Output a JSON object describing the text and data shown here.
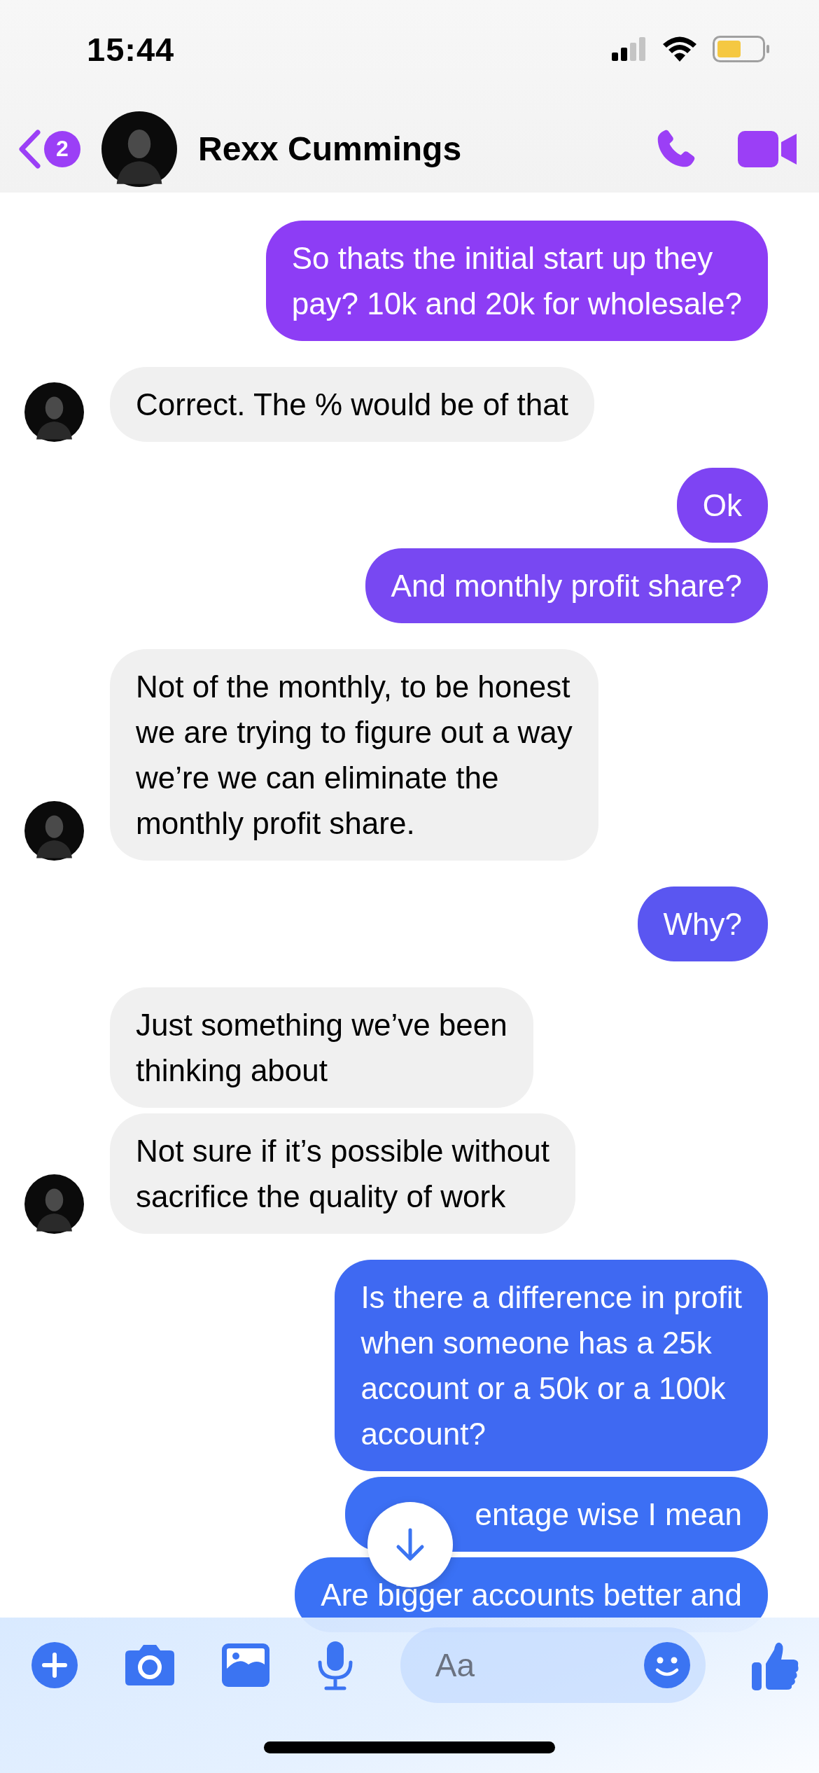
{
  "status_bar": {
    "time": "15:44"
  },
  "header": {
    "unread_count": "2",
    "contact_name": "Rexx Cummings"
  },
  "messages": [
    {
      "kind": "sent",
      "text": "So thats the initial start up they\npay? 10k and 20k for wholesale?",
      "color": "#8d3df5"
    },
    {
      "kind": "received",
      "text": "Correct. The % would be of that",
      "show_avatar": true
    },
    {
      "kind": "sent",
      "text": "Ok",
      "color": "#7e44f3"
    },
    {
      "kind": "sent",
      "text": "And monthly profit share?",
      "color": "#7848f2"
    },
    {
      "kind": "received",
      "text": "Not of the monthly, to be honest\nwe are trying to figure out a way\nwe’re we can eliminate the\nmonthly profit share.",
      "show_avatar": true
    },
    {
      "kind": "sent",
      "text": "Why?",
      "color": "#5a56f1"
    },
    {
      "kind": "received",
      "text": "Just something we’ve been\nthinking about",
      "show_avatar": false
    },
    {
      "kind": "received",
      "text": "Not sure if it’s possible without\nsacrifice the quality of work",
      "show_avatar": true
    },
    {
      "kind": "sent",
      "text": "Is there a difference in profit\nwhen someone has a 25k\naccount or a 50k or a 100k\naccount?",
      "color": "#3f69f2"
    },
    {
      "kind": "sent",
      "text": "entage wise I mean",
      "color": "#3c6ff4",
      "covered_by_button": true
    },
    {
      "kind": "sent",
      "text": "Are bigger accounts better and",
      "color": "#3a71f5"
    }
  ],
  "composer": {
    "placeholder": "Aa"
  }
}
